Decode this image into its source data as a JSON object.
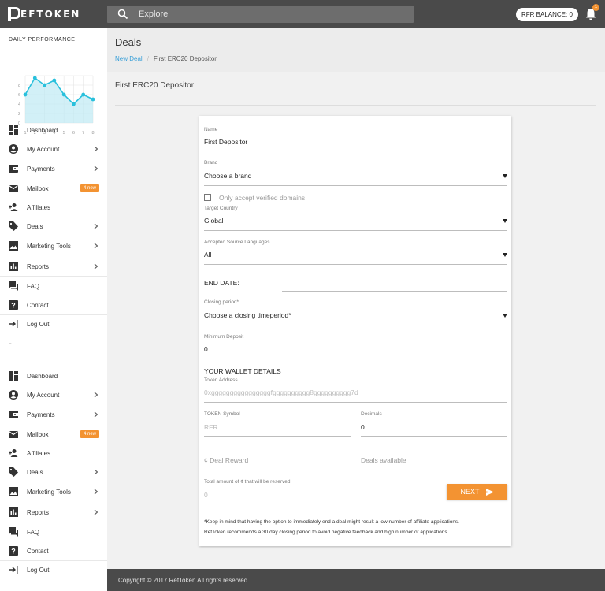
{
  "header": {
    "logo_text": "EFTOKEN",
    "search_placeholder": "Explore",
    "balance_label": "RFR BALANCE: 0",
    "notification_count": "1"
  },
  "sidebar": {
    "performance_title": "DAILY PERFORMANCE",
    "chart_y_ticks": [
      "8",
      "6",
      "4",
      "2",
      "0"
    ],
    "chart_x_ticks": [
      "1",
      "2",
      "3",
      "4",
      "5",
      "6",
      "7",
      "8"
    ],
    "chart_values": [
      6,
      9.5,
      8,
      9,
      6,
      4,
      6,
      5
    ],
    "second_chart_tick": "–",
    "items": [
      {
        "label": "Dashboard",
        "icon": "dashboard-icon"
      },
      {
        "label": "My Account",
        "icon": "account-icon"
      },
      {
        "label": "Payments",
        "icon": "wallet-icon"
      },
      {
        "label": "Mailbox",
        "icon": "mail-icon",
        "badge": "4 new"
      },
      {
        "label": "Affiliates",
        "icon": "affiliates-icon"
      },
      {
        "label": "Deals",
        "icon": "tag-icon"
      },
      {
        "label": "Marketing Tools",
        "icon": "image-icon"
      },
      {
        "label": "Reports",
        "icon": "chart-icon"
      },
      {
        "label": "FAQ",
        "icon": "forum-icon"
      },
      {
        "label": "Contact",
        "icon": "help-icon"
      },
      {
        "label": "Log Out",
        "icon": "logout-icon"
      }
    ]
  },
  "page": {
    "title": "Deals",
    "breadcrumb_link": "New Deal",
    "breadcrumb_sep": "/",
    "breadcrumb_current": "First ERC20 Depositor",
    "form_title": "First ERC20 Depositor"
  },
  "form": {
    "name_label": "Name",
    "name_value": "First Depositor",
    "brand_label": "Brand",
    "brand_value": "Choose a brand",
    "verified_label": "Only accept verified domains",
    "country_label": "Target Country",
    "country_value": "Global",
    "languages_label": "Accepted Source Languages",
    "languages_value": "All",
    "end_date_label": "END DATE:",
    "closing_label": "Closing period*",
    "closing_value": "Choose a closing timeperiod*",
    "min_deposit_label": "Minimum Deposit",
    "min_deposit_value": "0",
    "wallet_heading": "YOUR WALLET DETAILS",
    "token_address_label": "Token Address",
    "token_address_placeholder": "0xggggggggggggggggfgggggggggg8gggggggggg7d",
    "token_symbol_label": "TOKEN Symbol",
    "token_symbol_placeholder": "RFR",
    "decimals_label": "Decimals",
    "decimals_value": "0",
    "deal_reward_placeholder": "¢ Deal Reward",
    "deals_available_placeholder": "Deals available",
    "total_label": "Total amount of ¢ that will be reserved",
    "total_placeholder": "0",
    "next_label": "NEXT",
    "note_line1": "*Keep in mind that having the option to immediately end a deal might result a low number of affiliate applications.",
    "note_line2": "RefToken recommends a 30 day closing period to avoid negative feedback and high number of applications."
  },
  "footer": {
    "copyright": "Copyright © 2017 RefToken All rights reserved."
  },
  "colors": {
    "accent": "#f39332",
    "link": "#3aa0d8",
    "chart_line": "#28c0dc",
    "topbar": "#4a4a4a"
  }
}
